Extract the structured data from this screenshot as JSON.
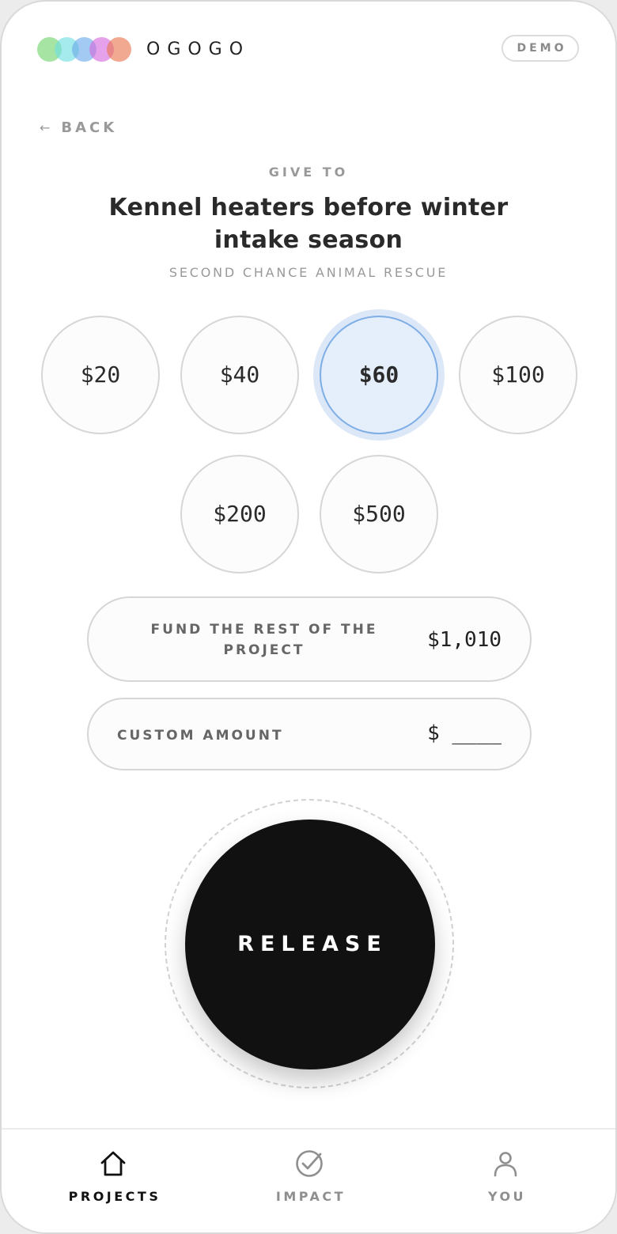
{
  "header": {
    "brand": "OGOGO",
    "badge": "DEMO",
    "logo_colors": [
      "#6fd36a",
      "#6ddde0",
      "#6aa9ea",
      "#d567dc",
      "#e8744e"
    ]
  },
  "nav_back": {
    "arrow": "←",
    "label": "BACK"
  },
  "project": {
    "give_to": "GIVE TO",
    "title": "Kennel heaters before winter intake season",
    "organization": "SECOND CHANCE ANIMAL RESCUE"
  },
  "amounts": [
    {
      "label": "$20",
      "selected": false
    },
    {
      "label": "$40",
      "selected": false
    },
    {
      "label": "$60",
      "selected": true
    },
    {
      "label": "$100",
      "selected": false
    },
    {
      "label": "$200",
      "selected": false
    },
    {
      "label": "$500",
      "selected": false
    }
  ],
  "fund_rest": {
    "label": "FUND THE REST OF THE PROJECT",
    "value": "$1,010"
  },
  "custom_amount": {
    "label": "CUSTOM AMOUNT",
    "value": "$ ____"
  },
  "release_button": {
    "label": "RELEASE"
  },
  "bottom_nav": {
    "items": [
      {
        "label": "PROJECTS",
        "icon": "home-icon",
        "active": true
      },
      {
        "label": "IMPACT",
        "icon": "check-circle-icon",
        "active": false
      },
      {
        "label": "YOU",
        "icon": "user-icon",
        "active": false
      }
    ]
  },
  "colors": {
    "accent_selected_bg": "#e5eefb",
    "accent_selected_border": "#7eaee6",
    "primary_button": "#111111",
    "nav_active": "#111111",
    "nav_inactive": "#8f8f8f"
  }
}
